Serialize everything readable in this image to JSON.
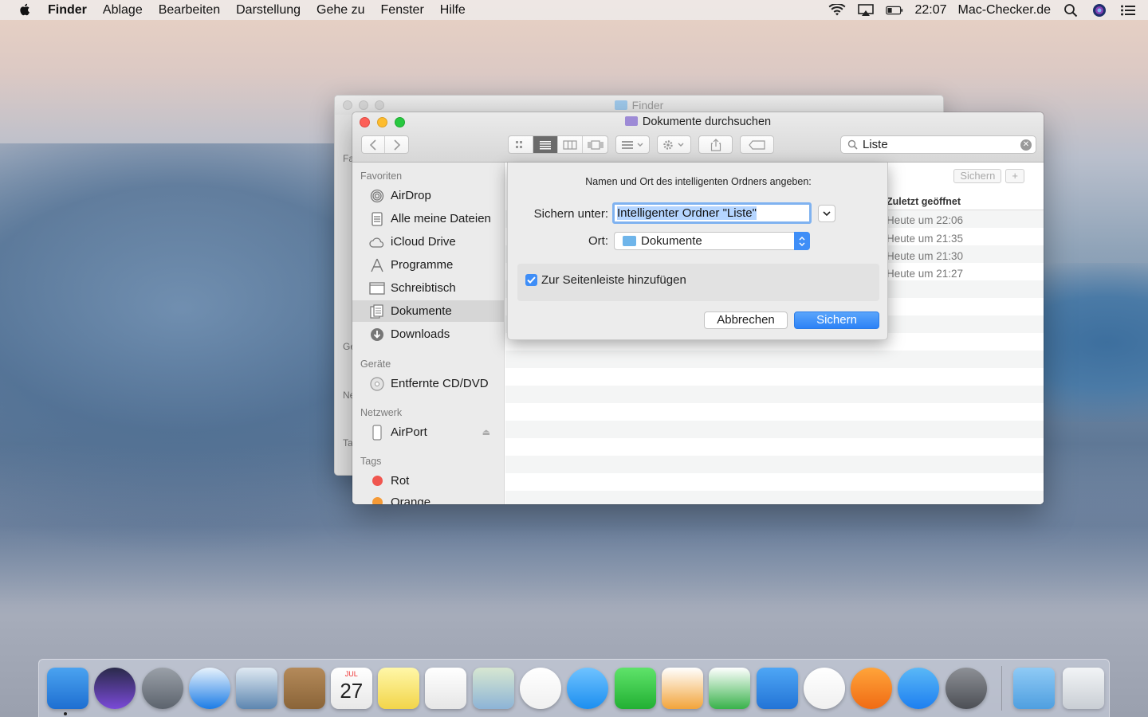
{
  "menubar": {
    "app_name": "Finder",
    "items": [
      "Ablage",
      "Bearbeiten",
      "Darstellung",
      "Gehe zu",
      "Fenster",
      "Hilfe"
    ],
    "clock": "22:07",
    "user": "Mac-Checker.de"
  },
  "back_window": {
    "title": "Finder",
    "sidebar_fragments": [
      "Fa",
      "Ge",
      "Ne",
      "Ta"
    ]
  },
  "window": {
    "title": "Dokumente durchsuchen",
    "search": {
      "value": "Liste"
    },
    "sidebar": {
      "sections": {
        "favorites": "Favoriten",
        "devices": "Geräte",
        "network": "Netzwerk",
        "tags": "Tags"
      },
      "favorites": [
        {
          "label": "AirDrop",
          "icon": "airdrop-icon"
        },
        {
          "label": "Alle meine Dateien",
          "icon": "all-files-icon"
        },
        {
          "label": "iCloud Drive",
          "icon": "cloud-icon"
        },
        {
          "label": "Programme",
          "icon": "applications-icon"
        },
        {
          "label": "Schreibtisch",
          "icon": "desktop-icon"
        },
        {
          "label": "Dokumente",
          "icon": "documents-icon",
          "selected": true
        },
        {
          "label": "Downloads",
          "icon": "downloads-icon"
        }
      ],
      "devices": [
        {
          "label": "Entfernte CD/DVD",
          "icon": "disc-icon"
        }
      ],
      "network": [
        {
          "label": "AirPort",
          "icon": "airport-icon"
        }
      ],
      "tags": [
        {
          "label": "Rot",
          "color": "#f0564f"
        },
        {
          "label": "Orange",
          "color": "#f59a36"
        }
      ]
    },
    "content": {
      "save_button": "Sichern",
      "add_button": "+",
      "column_header": "Zuletzt geöffnet",
      "rows": [
        "Heute um 22:06",
        "Heute um 21:35",
        "Heute um 21:30",
        "Heute um 21:27"
      ]
    }
  },
  "sheet": {
    "prompt": "Namen und Ort des intelligenten Ordners angeben:",
    "save_as_label": "Sichern unter:",
    "save_as_value": "Intelligenter Ordner \"Liste\"",
    "location_label": "Ort:",
    "location_value": "Dokumente",
    "checkbox_label": "Zur Seitenleiste hinzufügen",
    "checkbox_checked": true,
    "cancel": "Abbrechen",
    "save": "Sichern"
  },
  "dock": {
    "apps": [
      {
        "name": "finder-icon",
        "colors": [
          "#4aa3f0",
          "#1e6fd1"
        ]
      },
      {
        "name": "siri-icon",
        "colors": [
          "#2a2a4a",
          "#7a4ad8"
        ]
      },
      {
        "name": "launchpad-icon",
        "colors": [
          "#9aa0a8",
          "#5c636d"
        ]
      },
      {
        "name": "safari-icon",
        "colors": [
          "#e8f2fc",
          "#1b7ce6"
        ]
      },
      {
        "name": "mail-icon",
        "colors": [
          "#dfe9f2",
          "#5d86b0"
        ]
      },
      {
        "name": "contacts-icon",
        "colors": [
          "#b48a5a",
          "#8a6438"
        ]
      },
      {
        "name": "calendar-icon",
        "colors": [
          "#ffffff",
          "#e8e8e8"
        ]
      },
      {
        "name": "notes-icon",
        "colors": [
          "#fff7a8",
          "#f2d54a"
        ]
      },
      {
        "name": "reminders-icon",
        "colors": [
          "#ffffff",
          "#e6e6e6"
        ]
      },
      {
        "name": "preview-icon",
        "colors": [
          "#d7e7d1",
          "#8db4d6"
        ]
      },
      {
        "name": "photos-icon",
        "colors": [
          "#ffffff",
          "#f0f0f0"
        ]
      },
      {
        "name": "messages-icon",
        "colors": [
          "#6fc3ff",
          "#1c8ff0"
        ]
      },
      {
        "name": "facetime-icon",
        "colors": [
          "#5fe36a",
          "#22b033"
        ]
      },
      {
        "name": "pages-icon",
        "colors": [
          "#ffffff",
          "#f2a43a"
        ]
      },
      {
        "name": "numbers-icon",
        "colors": [
          "#ffffff",
          "#38b24a"
        ]
      },
      {
        "name": "keynote-icon",
        "colors": [
          "#4ea6f5",
          "#2374d6"
        ]
      },
      {
        "name": "itunes-icon",
        "colors": [
          "#ffffff",
          "#f0f0f0"
        ]
      },
      {
        "name": "ibooks-icon",
        "colors": [
          "#ffa43a",
          "#f06b14"
        ]
      },
      {
        "name": "app-store-icon",
        "colors": [
          "#5ab8f7",
          "#1d7ff0"
        ]
      },
      {
        "name": "system-preferences-icon",
        "colors": [
          "#8d9096",
          "#4c4f55"
        ]
      }
    ],
    "calendar_month": "JUL",
    "calendar_day": "27",
    "right": [
      {
        "name": "downloads-folder-icon",
        "colors": [
          "#8fcaf5",
          "#4f9fe0"
        ]
      },
      {
        "name": "trash-icon",
        "colors": [
          "#f2f4f6",
          "#c9ced4"
        ]
      }
    ]
  }
}
